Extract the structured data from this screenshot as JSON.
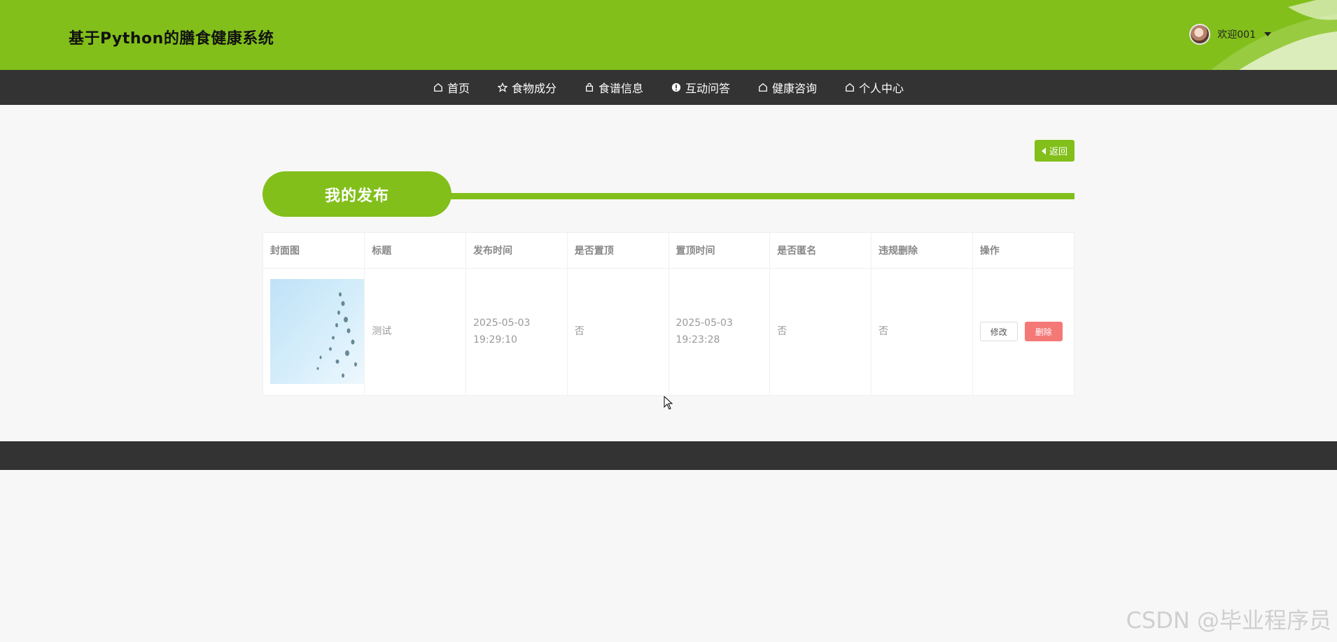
{
  "header": {
    "site_title": "基于Python的膳食健康系统",
    "user_label": "欢迎001"
  },
  "nav": {
    "items": [
      {
        "label": "首页",
        "icon": "home-icon"
      },
      {
        "label": "食物成分",
        "icon": "star-icon"
      },
      {
        "label": "食谱信息",
        "icon": "bag-icon"
      },
      {
        "label": "互动问答",
        "icon": "alert-circle-icon"
      },
      {
        "label": "健康咨询",
        "icon": "home-icon"
      },
      {
        "label": "个人中心",
        "icon": "home-icon"
      }
    ]
  },
  "main": {
    "back_label": "返回",
    "section_title": "我的发布",
    "table": {
      "headers": [
        "封面图",
        "标题",
        "发布时间",
        "是否置顶",
        "置顶时间",
        "是否匿名",
        "违规删除",
        "操作"
      ],
      "rows": [
        {
          "title": "测试",
          "publish_time": "2025-05-03 19:29:10",
          "is_top": "否",
          "top_time": "2025-05-03 19:23:28",
          "is_anonymous": "否",
          "violation_deleted": "否",
          "edit_label": "修改",
          "delete_label": "删除"
        }
      ]
    }
  },
  "watermark": "CSDN @毕业程序员",
  "colors": {
    "brand_green": "#82bf1b",
    "nav_dark": "#333333",
    "danger": "#f47876"
  }
}
